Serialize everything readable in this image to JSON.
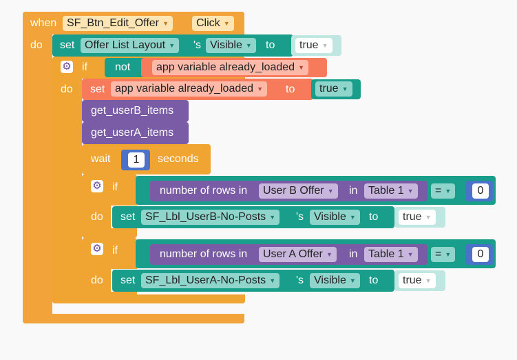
{
  "event": {
    "when": "when",
    "component": "SF_Btn_Edit_Offer",
    "event_name": "Click",
    "do": "do"
  },
  "set1": {
    "set": "set",
    "component": "Offer List Layout",
    "s": "'s",
    "property": "Visible",
    "to": "to",
    "value": "true"
  },
  "if1": {
    "if": "if",
    "not": "not",
    "variable": "app variable already_loaded",
    "do": "do"
  },
  "set2": {
    "set": "set",
    "variable": "app variable already_loaded",
    "to": "to",
    "value": "true"
  },
  "calls": {
    "b": "get_userB_items",
    "a": "get_userA_items"
  },
  "wait": {
    "label": "wait",
    "value": "1",
    "unit": "seconds"
  },
  "if2": {
    "if": "if",
    "num_rows": "number of rows in",
    "entity": "User B Offer",
    "in": "in",
    "table": "Table 1",
    "op": "=",
    "num": "0",
    "do": "do"
  },
  "set3": {
    "set": "set",
    "component": "SF_Lbl_UserB-No-Posts",
    "s": "'s",
    "property": "Visible",
    "to": "to",
    "value": "true"
  },
  "if3": {
    "if": "if",
    "num_rows": "number of rows in",
    "entity": "User A Offer",
    "in": "in",
    "table": "Table 1",
    "op": "=",
    "num": "0",
    "do": "do"
  },
  "set4": {
    "set": "set",
    "component": "SF_Lbl_UserA-No-Posts",
    "s": "'s",
    "property": "Visible",
    "to": "to",
    "value": "true"
  },
  "colors": {
    "event": "#f2a33a",
    "control": "#f0a532",
    "component": "#1a9e8c",
    "variable": "#f77b5b",
    "procedure": "#7a5ba5",
    "math": "#4a72c8"
  },
  "icons": {
    "mutator": "gear-icon",
    "dropdown": "chevron-down-icon"
  }
}
